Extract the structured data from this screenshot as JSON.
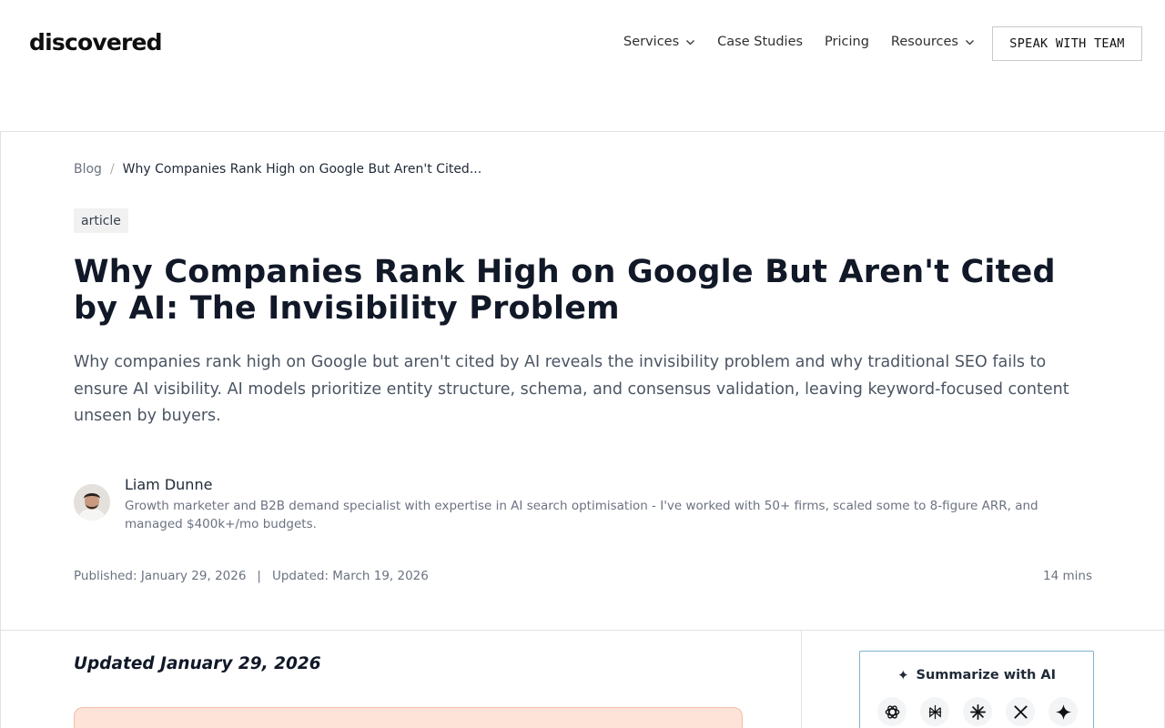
{
  "header": {
    "logo": "discovered",
    "nav": [
      {
        "label": "Services",
        "dropdown": true
      },
      {
        "label": "Case Studies",
        "dropdown": false
      },
      {
        "label": "Pricing",
        "dropdown": false
      },
      {
        "label": "Resources",
        "dropdown": true
      }
    ],
    "cta_label": "SPEAK WITH TEAM"
  },
  "breadcrumb": {
    "root": "Blog",
    "separator": "/",
    "current": "Why Companies Rank High on Google But Aren't Cited..."
  },
  "article": {
    "tag": "article",
    "title": "Why Companies Rank High on Google But Aren't Cited by AI: The Invisibility Problem",
    "subtitle": "Why companies rank high on Google but aren't cited by AI reveals the invisibility problem and why traditional SEO fails to ensure AI visibility. AI models prioritize entity structure, schema, and consensus validation, leaving keyword-focused content unseen by buyers.",
    "author": {
      "name": "Liam Dunne",
      "bio": "Growth marketer and B2B demand specialist with expertise in AI search optimisation - I've worked with 50+ firms, scaled some to 8-figure ARR, and managed $400k+/mo budgets."
    },
    "published": "Published: January 29, 2026",
    "meta_separator": "|",
    "updated": "Updated: March 19, 2026",
    "read_time": "14 mins"
  },
  "content": {
    "updated_heading": "Updated January 29, 2026"
  },
  "ai_summary": {
    "title": "Summarize with AI",
    "icons": [
      "chatgpt-icon",
      "perplexity-icon",
      "claude-icon",
      "x-grok-icon",
      "gemini-icon"
    ]
  },
  "colors": {
    "tldr_bg": "#fde3d8",
    "ai_box_border": "#7fb2c9"
  }
}
